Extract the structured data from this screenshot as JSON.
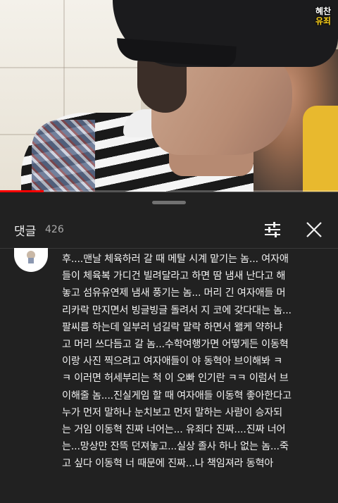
{
  "video": {
    "channel_logo": {
      "line1": "혜찬",
      "line2": "유죄"
    },
    "progress_fraction": 0.13
  },
  "comments_panel": {
    "title": "댓글",
    "count": "426",
    "icons": {
      "filter": "sliders-icon",
      "close": "close-icon"
    },
    "comment": {
      "avatar": "user-avatar",
      "lines": [
        "후....맨날 체육하러 갈 때 메탈 시계 맡기는 놈... 여자애",
        "들이 체육복 가디건 빌려달라고 하면 땀 냄새 난다고 해",
        "놓고 섬유유연제 냄새 풍기는 놈... 머리 긴 여자애들 머",
        "리카락 만지면서 빙글빙글 돌려서 지 코에 갖다대는 놈...",
        "팔씨름 하는데 일부러 넘길락 말락 하면서 왤케 약하냐",
        "고 머리 쓰다듬고 갈 놈...수학여행가면 어떻게든 이동혁",
        "이랑 사진 찍으려고 여자애들이 야 동혁아 브이해봐 ㅋ",
        "ㅋ 이러면 허세부리는 척 이 오빠 인기란 ㅋㅋ 이럼서 브",
        "이해줄 놈....진실게임 할 때 여자애들 이동혁 좋아한다고",
        "누가 먼저 말하나 눈치보고 먼저 말하는 사람이 승자되",
        "는 거임 이동혁 진짜 너어는... 유죄다 진짜....진짜 너어",
        "는...망상만 잔뜩 던져놓고...실상 졸사 하나 없는 놈...죽",
        "고 싶다 이동혁 너 때문에 진짜...나 책임져라 동혁아"
      ]
    }
  }
}
